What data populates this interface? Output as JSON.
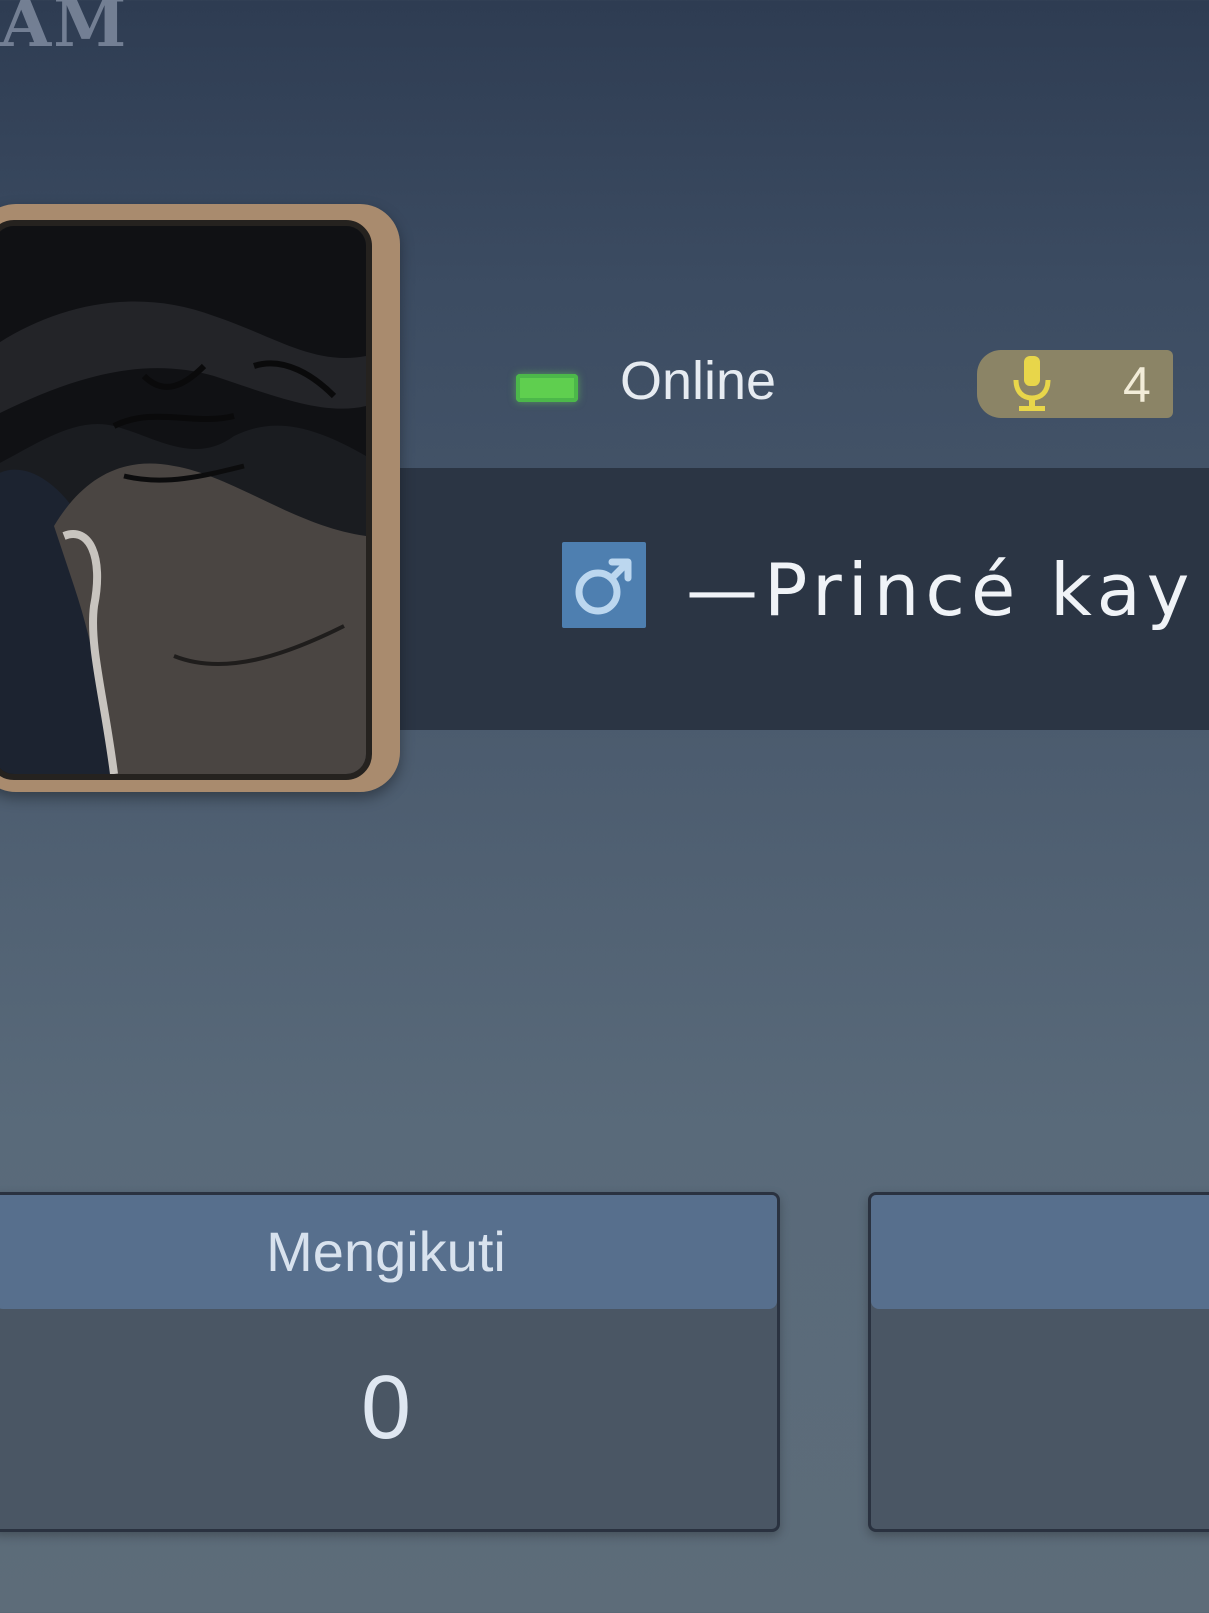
{
  "header": {
    "corner_title": "AM"
  },
  "profile": {
    "status": "Online",
    "mic_count": "4",
    "gender_symbol": "♂",
    "player_name": "—Princé kay",
    "colors": {
      "online": "#5fcf4f",
      "name_bar": "#2b3544",
      "frame": "#a98b6e",
      "gender_badge": "#4e7fb0",
      "mic_badge": "#8b8466"
    }
  },
  "stats": [
    {
      "label": "Mengikuti",
      "value": "0"
    },
    {
      "label": "",
      "value": ""
    }
  ],
  "icons": {
    "status": "online-status-icon",
    "mic": "microphone-icon",
    "gender": "male-gender-icon",
    "avatar": "anime-avatar-image"
  }
}
